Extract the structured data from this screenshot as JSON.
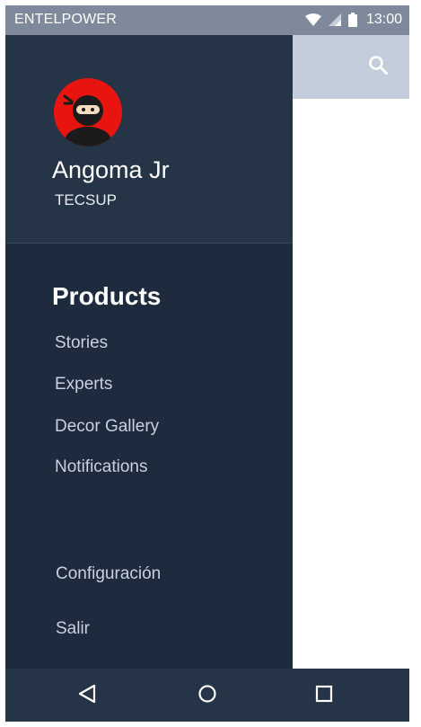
{
  "status_bar": {
    "carrier": "ENTELPOWER",
    "time": "13:00"
  },
  "app_bar": {
    "search_icon": "search-icon",
    "background": "#c3cddb"
  },
  "drawer": {
    "header": {
      "avatar_icon": "ninja-avatar-icon",
      "name": "Angoma Jr",
      "organization": "TECSUP"
    },
    "section_title": "Products",
    "items": [
      {
        "label": "Stories"
      },
      {
        "label": "Experts"
      },
      {
        "label": "Decor Gallery"
      },
      {
        "label": "Notifications"
      }
    ],
    "footer_items": [
      {
        "label": "Configuración"
      },
      {
        "label": "Salir"
      }
    ],
    "colors": {
      "background": "#1e2b3e",
      "header": "#263447",
      "item_text": "#c8d1de"
    }
  },
  "nav_bar": {
    "buttons": [
      "back-icon",
      "home-icon",
      "recents-icon"
    ]
  }
}
